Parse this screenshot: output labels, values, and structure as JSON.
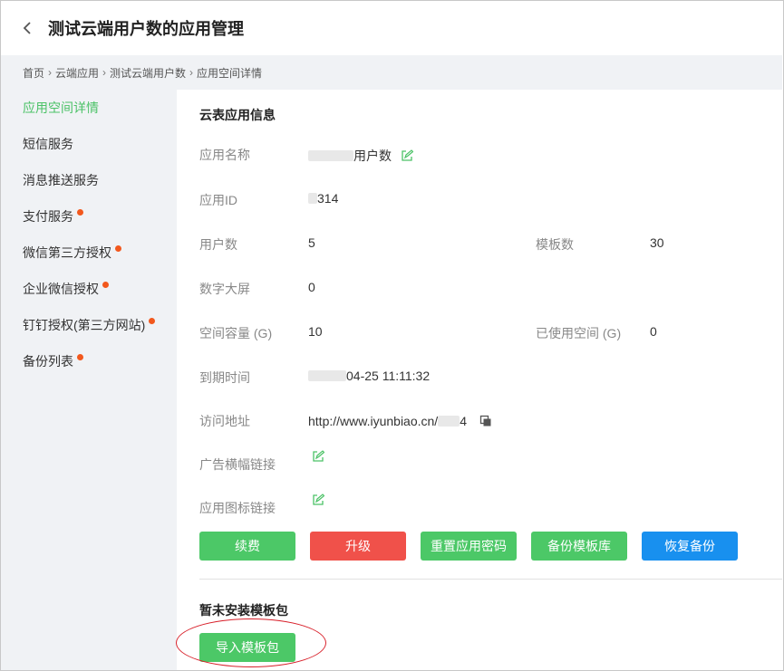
{
  "header": {
    "title": "测试云端用户数的应用管理"
  },
  "breadcrumb": [
    "首页",
    "云端应用",
    "测试云端用户数",
    "应用空间详情"
  ],
  "sidebar": {
    "items": [
      {
        "label": "应用空间详情",
        "active": true,
        "dot": false
      },
      {
        "label": "短信服务",
        "active": false,
        "dot": false
      },
      {
        "label": "消息推送服务",
        "active": false,
        "dot": false
      },
      {
        "label": "支付服务",
        "active": false,
        "dot": true
      },
      {
        "label": "微信第三方授权",
        "active": false,
        "dot": true
      },
      {
        "label": "企业微信授权",
        "active": false,
        "dot": true
      },
      {
        "label": "钉钉授权(第三方网站)",
        "active": false,
        "dot": true
      },
      {
        "label": "备份列表",
        "active": false,
        "dot": true
      }
    ]
  },
  "info": {
    "section_title": "云表应用信息",
    "app_name_label": "应用名称",
    "app_name_value": "用户数",
    "app_id_label": "应用ID",
    "app_id_value": "314",
    "users_label": "用户数",
    "users_value": "5",
    "templates_label": "模板数",
    "templates_value": "30",
    "screen_label": "数字大屏",
    "screen_value": "0",
    "capacity_label": "空间容量 (G)",
    "capacity_value": "10",
    "used_label": "已使用空间 (G)",
    "used_value": "0",
    "expire_label": "到期时间",
    "expire_value": "04-25 11:11:32",
    "url_label": "访问地址",
    "url_value": "http://www.iyunbiao.cn/",
    "url_tail": "4",
    "banner_label": "广告横幅链接",
    "icon_link_label": "应用图标链接"
  },
  "buttons": {
    "renew": "续费",
    "upgrade": "升级",
    "reset_password": "重置应用密码",
    "backup_templates": "备份模板库",
    "restore_backup": "恢复备份"
  },
  "package": {
    "title": "暂未安装模板包",
    "import_button": "导入模板包"
  },
  "colors": {
    "green": "#4cc867",
    "red": "#f0514a",
    "blue": "#1890ef",
    "active_text": "#4cc267",
    "dot": "#f2581d",
    "annotation": "#d8202a"
  }
}
